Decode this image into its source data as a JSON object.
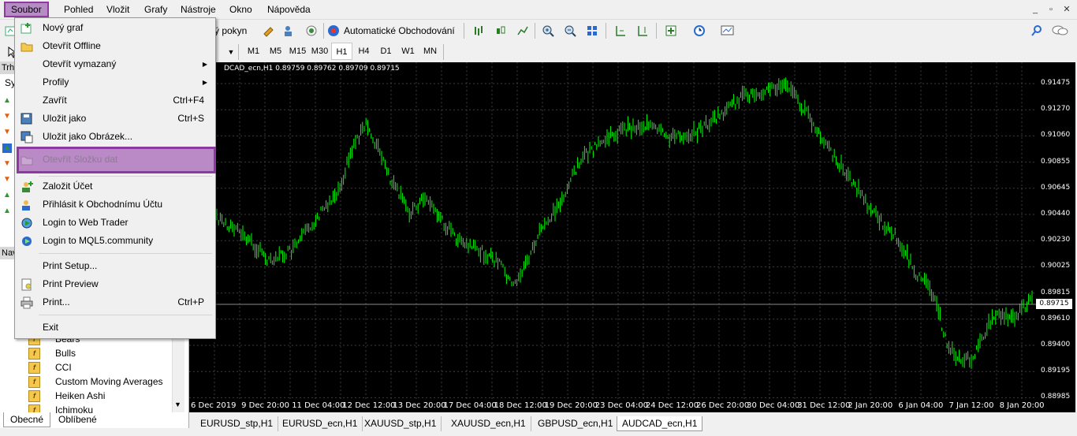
{
  "menubar": {
    "items": [
      "Soubor",
      "Pohled",
      "Vložit",
      "Grafy",
      "Nástroje",
      "Okno",
      "Nápověda"
    ],
    "window_controls": [
      "_",
      "▫",
      "✕"
    ]
  },
  "toolbar": {
    "new_order_label": "ý pokyn",
    "algo_trading_label": "Automatické Obchodování",
    "timeframes": [
      "M1",
      "M5",
      "M15",
      "M30",
      "H1",
      "H4",
      "D1",
      "W1",
      "MN"
    ],
    "selected_timeframe": "H1"
  },
  "file_menu": {
    "items": [
      {
        "label": "Nový graf",
        "shortcut": "",
        "icon": "new-chart-icon",
        "submenu": false
      },
      {
        "label": "Otevřít Offline",
        "shortcut": "",
        "icon": "folder-icon",
        "submenu": false
      },
      {
        "label": "Otevřít vymazaný",
        "shortcut": "",
        "icon": "",
        "submenu": true
      },
      {
        "label": "Profily",
        "shortcut": "",
        "icon": "",
        "submenu": true
      },
      {
        "label": "Zavřít",
        "shortcut": "Ctrl+F4",
        "icon": "",
        "submenu": false
      },
      {
        "label": "Uložit jako",
        "shortcut": "Ctrl+S",
        "icon": "save-icon",
        "submenu": false
      },
      {
        "label": "Uložit jako Obrázek...",
        "shortcut": "",
        "icon": "save-picture-icon",
        "submenu": false
      },
      {
        "label": "Otevřít Složku dat",
        "shortcut": "",
        "icon": "folder-icon",
        "submenu": false
      },
      {
        "label": "Založit Účet",
        "shortcut": "",
        "icon": "add-account-icon",
        "submenu": false
      },
      {
        "label": "Přihlásit k Obchodnímu Účtu",
        "shortcut": "",
        "icon": "login-account-icon",
        "submenu": false
      },
      {
        "label": "Login to Web Trader",
        "shortcut": "",
        "icon": "web-trader-icon",
        "submenu": false
      },
      {
        "label": "Login to MQL5.community",
        "shortcut": "",
        "icon": "mql5-icon",
        "submenu": false
      },
      {
        "label": "Print Setup...",
        "shortcut": "",
        "icon": "",
        "submenu": false
      },
      {
        "label": "Print Preview",
        "shortcut": "",
        "icon": "print-preview-icon",
        "submenu": false
      },
      {
        "label": "Print...",
        "shortcut": "Ctrl+P",
        "icon": "printer-icon",
        "submenu": false
      },
      {
        "label": "Exit",
        "shortcut": "",
        "icon": "",
        "submenu": false
      }
    ]
  },
  "left_pane": {
    "market_watch_head": "Trh",
    "symbol_head": "Sy",
    "navigator_head": "Nav",
    "indicators": [
      "Bears",
      "Bulls",
      "CCI",
      "Custom Moving Averages",
      "Heiken Ashi",
      "Ichimoku"
    ],
    "tabs": [
      "Obecné",
      "Oblíbené"
    ],
    "selected_tab": "Obecné"
  },
  "chart": {
    "title": "DCAD_ecn,H1  0.89759 0.89762 0.89709 0.89715",
    "current_price": "0.89715",
    "price_labels": [
      "0.91475",
      "0.91270",
      "0.91060",
      "0.90855",
      "0.90645",
      "0.90440",
      "0.90230",
      "0.90025",
      "0.89815",
      "0.89610",
      "0.89400",
      "0.89195",
      "0.88985"
    ],
    "time_labels": [
      "6 Dec 2019",
      "9 Dec 20:00",
      "11 Dec 04:00",
      "12 Dec 12:00",
      "13 Dec 20:00",
      "17 Dec 04:00",
      "18 Dec 12:00",
      "19 Dec 20:00",
      "23 Dec 04:00",
      "24 Dec 12:00",
      "26 Dec 20:00",
      "30 Dec 04:00",
      "31 Dec 12:00",
      "2 Jan 20:00",
      "6 Jan 04:00",
      "7 Jan 12:00",
      "8 Jan 20:00"
    ],
    "candle_color": "#00ff00",
    "grid_color": "#3c3c3c"
  },
  "chart_tabs": {
    "items": [
      "EURUSD_stp,H1",
      "EURUSD_ecn,H1",
      "XAUUSD_stp,H1",
      "XAUUSD_ecn,H1",
      "GBPUSD_ecn,H1",
      "AUDCAD_ecn,H1"
    ],
    "selected": "AUDCAD_ecn,H1"
  }
}
